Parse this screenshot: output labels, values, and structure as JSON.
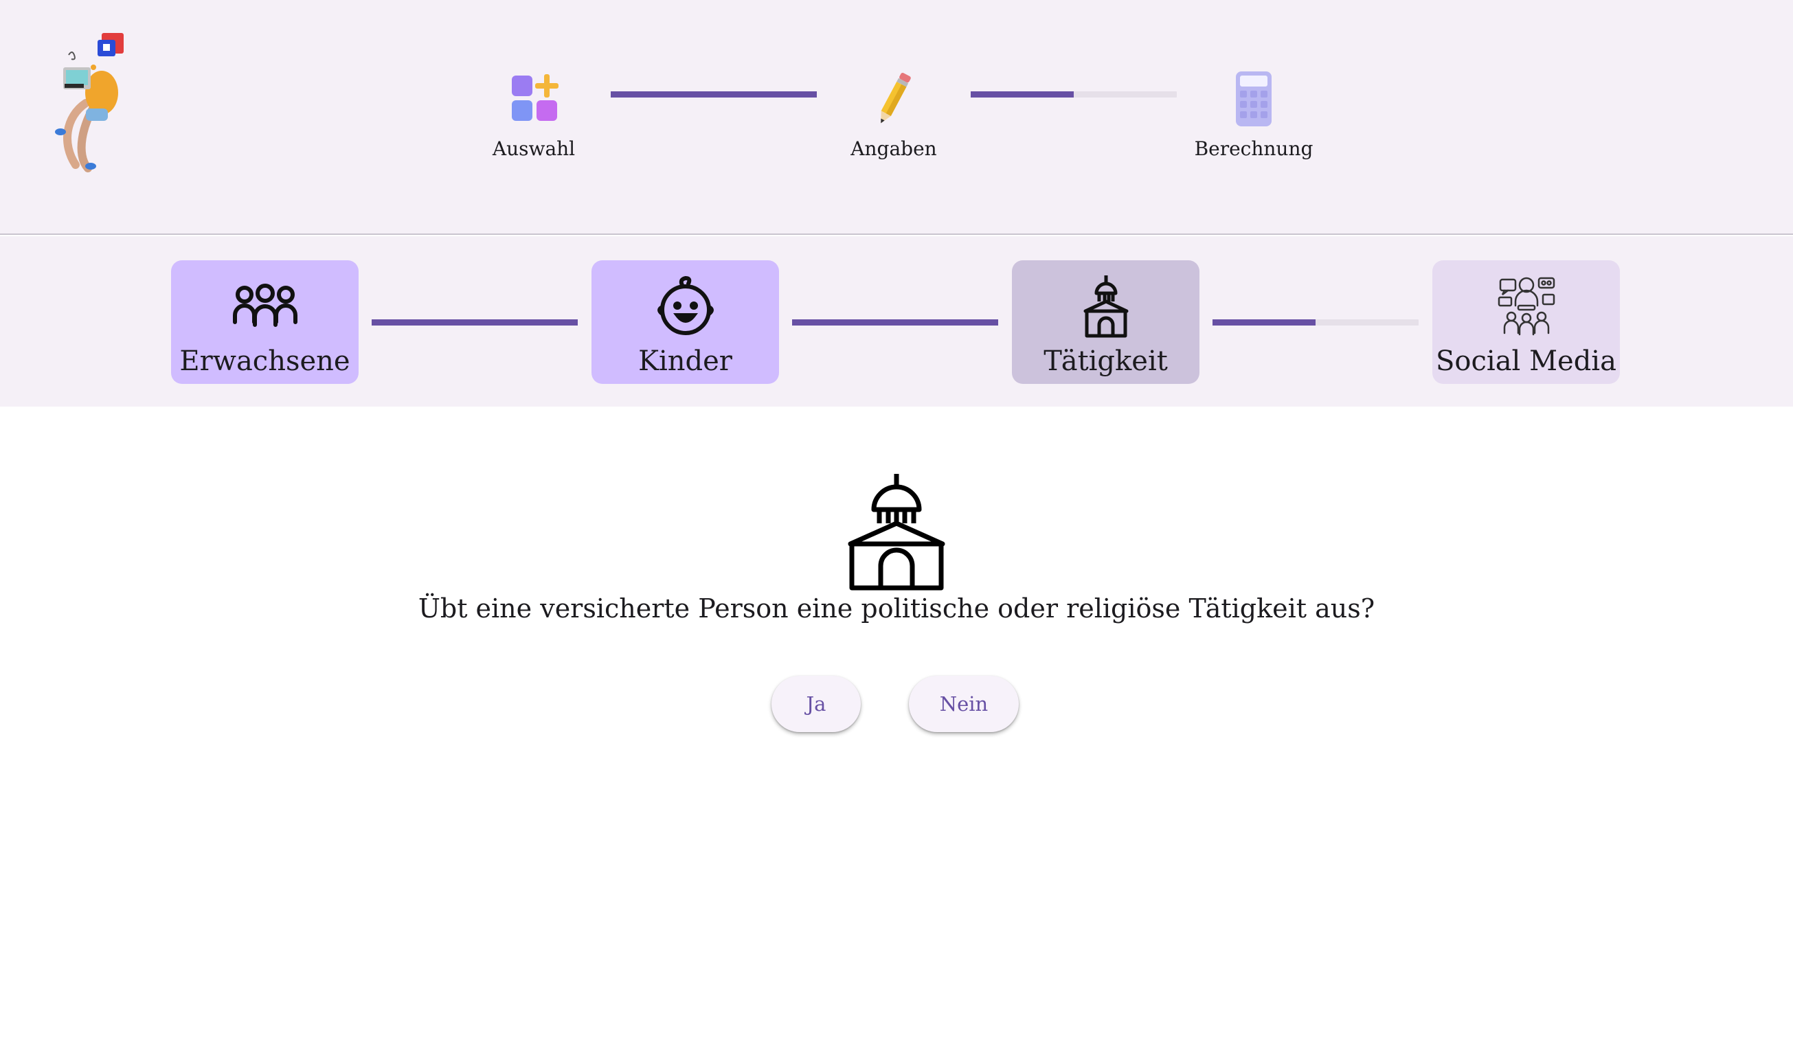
{
  "header": {
    "logo": "person-with-laptop-illustration",
    "steps": [
      {
        "label": "Auswahl",
        "icon": "apps-plus-icon"
      },
      {
        "label": "Angaben",
        "icon": "pencil-icon"
      },
      {
        "label": "Berechnung",
        "icon": "calculator-icon"
      }
    ],
    "progress": [
      1.0,
      0.5
    ]
  },
  "categories": {
    "items": [
      {
        "label": "Erwachsene",
        "icon": "adults-group-icon",
        "state": "completed"
      },
      {
        "label": "Kinder",
        "icon": "baby-face-icon",
        "state": "completed"
      },
      {
        "label": "Tätigkeit",
        "icon": "capitol-building-icon",
        "state": "current"
      },
      {
        "label": "Social Media",
        "icon": "social-media-influencer-icon",
        "state": "upcoming"
      }
    ],
    "progress": [
      1.0,
      1.0,
      0.5
    ]
  },
  "main": {
    "icon": "capitol-building-icon",
    "question": "Übt eine versicherte Person eine politische oder religiöse Tätigkeit aus?",
    "yes_label": "Ja",
    "no_label": "Nein"
  },
  "colors": {
    "accent": "#6750a4",
    "header_bg": "#f5f0f7",
    "track": "#e6e0e9",
    "completed_tile": "#d0bcff",
    "current_tile": "#ccc2dc",
    "upcoming_tile": "#e6dbf1",
    "button_bg": "#f7f2fa"
  }
}
